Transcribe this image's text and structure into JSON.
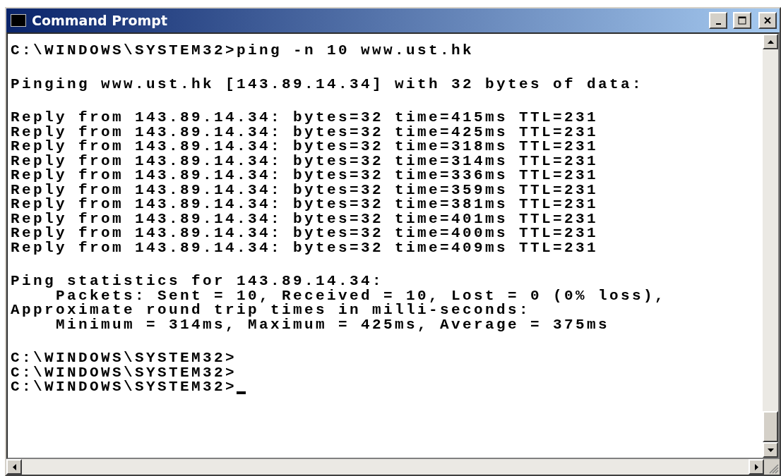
{
  "window": {
    "title": "Command Prompt"
  },
  "console": {
    "cursor": true,
    "blocks": [
      [
        "C:\\WINDOWS\\SYSTEM32>ping -n 10 www.ust.hk"
      ],
      [
        "Pinging www.ust.hk [143.89.14.34] with 32 bytes of data:"
      ],
      [
        "Reply from 143.89.14.34: bytes=32 time=415ms TTL=231",
        "Reply from 143.89.14.34: bytes=32 time=425ms TTL=231",
        "Reply from 143.89.14.34: bytes=32 time=318ms TTL=231",
        "Reply from 143.89.14.34: bytes=32 time=314ms TTL=231",
        "Reply from 143.89.14.34: bytes=32 time=336ms TTL=231",
        "Reply from 143.89.14.34: bytes=32 time=359ms TTL=231",
        "Reply from 143.89.14.34: bytes=32 time=381ms TTL=231",
        "Reply from 143.89.14.34: bytes=32 time=401ms TTL=231",
        "Reply from 143.89.14.34: bytes=32 time=400ms TTL=231",
        "Reply from 143.89.14.34: bytes=32 time=409ms TTL=231"
      ],
      [
        "Ping statistics for 143.89.14.34:",
        "    Packets: Sent = 10, Received = 10, Lost = 0 (0% loss),",
        "Approximate round trip times in milli-seconds:",
        "    Minimum = 314ms, Maximum = 425ms, Average = 375ms"
      ],
      [
        "C:\\WINDOWS\\SYSTEM32>",
        "C:\\WINDOWS\\SYSTEM32>",
        "C:\\WINDOWS\\SYSTEM32>"
      ]
    ]
  }
}
